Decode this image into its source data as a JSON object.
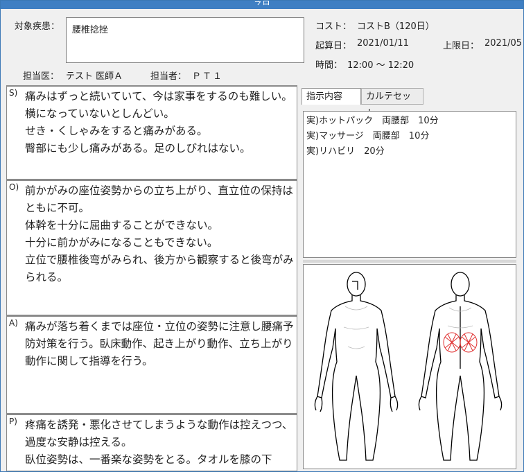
{
  "window": {
    "title": "今日"
  },
  "header": {
    "disease_label": "対象疾患：",
    "disease_value": "腰椎捻挫",
    "doctor_label": "担当医：",
    "doctor_value": "テスト 医師Ａ",
    "staff_label": "担当者：",
    "staff_value": "ＰＴ１",
    "cost_label": "コスト：",
    "cost_value": "コストB（120日）",
    "start_label": "起算日：",
    "start_value": "2021/01/11",
    "limit_label": "上限日：",
    "limit_value": "2021/05",
    "time_label": "時間：",
    "time_value": "12:00 ～ 12:20"
  },
  "soap": {
    "s": {
      "tag": "S)",
      "text": "痛みはずっと続いていて、今は家事をするのも難しい。横になっていないとしんどい。\nせき・くしゃみをすると痛みがある。\n臀部にも少し痛みがある。足のしびれはない。"
    },
    "o": {
      "tag": "O)",
      "text": "前かがみの座位姿勢からの立ち上がり、直立位の保持はともに不可。\n体幹を十分に屈曲することができない。\n十分に前かがみになることもできない。\n立位で腰椎後弯がみられ、後方から観察すると後弯がみられる。"
    },
    "a": {
      "tag": "A)",
      "text": "痛みが落ち着くまでは座位・立位の姿勢に注意し腰痛予防対策を行う。臥床動作、起き上がり動作、立ち上がり動作に関して指導を行う。"
    },
    "p": {
      "tag": "P)",
      "text": "疼痛を誘発・悪化させてしまうような動作は控えつつ、過度な安静は控える。\n臥位姿勢は、一番楽な姿勢をとる。タオルを膝の下"
    }
  },
  "tabs": {
    "instruction": "指示内容",
    "karte_set": "カルテセット"
  },
  "instructions": [
    "実)ホットパック　両腰部　10分",
    "実)マッサージ　両腰部　10分",
    "実)リハビリ　20分"
  ],
  "colors": {
    "accent": "#3f7fc3",
    "pain_mark": "#e03030"
  }
}
